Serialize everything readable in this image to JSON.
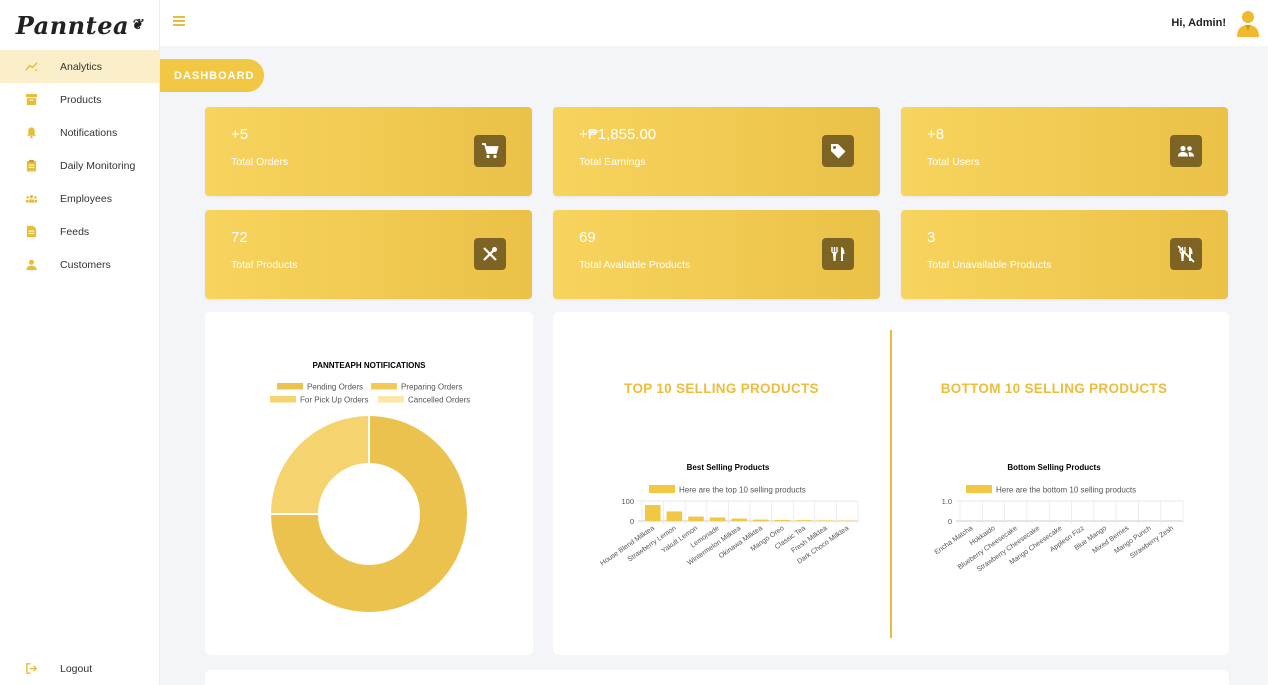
{
  "brand": {
    "name": "Panntea"
  },
  "sidebar": {
    "items": [
      {
        "label": "Analytics",
        "icon": "trend-icon",
        "active": true
      },
      {
        "label": "Products",
        "icon": "archive-icon"
      },
      {
        "label": "Notifications",
        "icon": "bell-icon"
      },
      {
        "label": "Daily Monitoring",
        "icon": "clipboard-icon"
      },
      {
        "label": "Employees",
        "icon": "group-icon"
      },
      {
        "label": "Feeds",
        "icon": "document-icon"
      },
      {
        "label": "Customers",
        "icon": "person-icon"
      }
    ],
    "logout_label": "Logout"
  },
  "header": {
    "greeting": "Hi, Admin!"
  },
  "page": {
    "tab_label": "DASHBOARD"
  },
  "stats": [
    {
      "value": "+5",
      "label": "Total Orders",
      "icon": "cart-icon"
    },
    {
      "value": "+₱1,855.00",
      "label": "Total Earnings",
      "icon": "tag-icon"
    },
    {
      "value": "+8",
      "label": "Total Users",
      "icon": "users-icon"
    },
    {
      "value": "72",
      "label": "Total Products",
      "icon": "utensils-cross-icon"
    },
    {
      "value": "69",
      "label": "Total Available Products",
      "icon": "fork-knife-icon"
    },
    {
      "value": "3",
      "label": "Total Unavailable Products",
      "icon": "no-food-icon"
    }
  ],
  "colors": {
    "accent": "#f2c744",
    "icon_bg": "#7e6424",
    "title": "#edbd3b"
  },
  "panels": {
    "top_title": "TOP 10 SELLING PRODUCTS",
    "bottom_title": "BOTTOM 10 SELLING PRODUCTS"
  },
  "chart_data": [
    {
      "type": "pie",
      "title": "PANNTEAPH NOTIFICATIONS",
      "categories": [
        "Pending Orders",
        "Preparing Orders",
        "For Pick Up Orders",
        "Cancelled Orders"
      ],
      "values": [
        75,
        0,
        25,
        0
      ],
      "colors": [
        "#ebc24d",
        "#f2ca55",
        "#f5d470",
        "#fbe8a6"
      ],
      "legend": "top"
    },
    {
      "type": "bar",
      "title": "Best Selling Products",
      "series": [
        {
          "name": "Here are the top 10 selling products",
          "values": [
            80,
            48,
            22,
            18,
            12,
            7,
            5,
            4,
            3,
            2
          ]
        }
      ],
      "categories": [
        "House Blend Milktea",
        "Strawberry Lemon",
        "Yakult Lemon",
        "Lemonade",
        "Wintermelon Milktea",
        "Okinawa Milktea",
        "Mango Oreo",
        "Classic Tea",
        "Fresh Milktea",
        "Dark Choco Milktea"
      ],
      "ylim": [
        0,
        100
      ],
      "yticks": [
        "100",
        "0"
      ],
      "legend": "top"
    },
    {
      "type": "bar",
      "title": "Bottom Selling Products",
      "series": [
        {
          "name": "Here are the bottom 10 selling products",
          "values": [
            0,
            0,
            0,
            0,
            0,
            0,
            0,
            0,
            0,
            0
          ]
        }
      ],
      "categories": [
        "Encha Matcha",
        "Hokkaido",
        "Blueberry Cheesecake",
        "Strawberry Cheesecake",
        "Mango Cheesecake",
        "Applesn Fizz",
        "Blue Mango",
        "Mixed Berries",
        "Mango Punch",
        "Strawberry Zesh"
      ],
      "ylim": [
        0,
        1
      ],
      "yticks": [
        "1.0",
        "0"
      ],
      "legend": "top"
    }
  ]
}
